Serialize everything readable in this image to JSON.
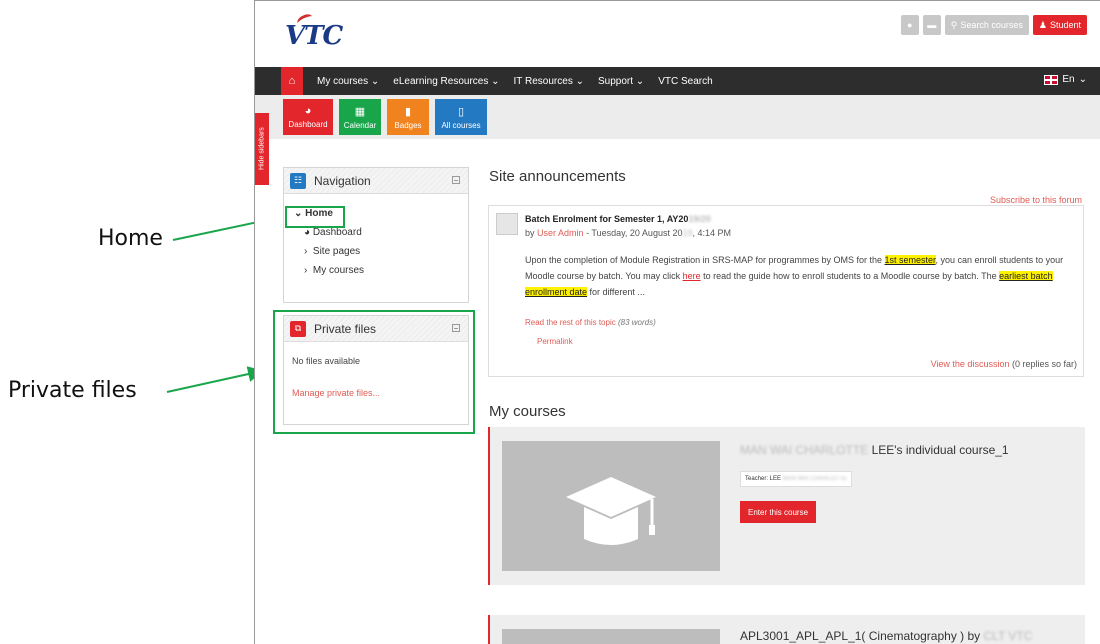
{
  "callouts": {
    "home": "Home",
    "private_files": "Private files"
  },
  "header": {
    "logo_text": "VTC",
    "search_label": "Search courses",
    "user_label": "Student"
  },
  "navbar": {
    "items": [
      "My courses",
      "eLearning Resources",
      "IT Resources",
      "Support",
      "VTC Search"
    ],
    "language": "En"
  },
  "quickbar": {
    "items": [
      {
        "label": "Dashboard",
        "color": "#e3262b"
      },
      {
        "label": "Calendar",
        "color": "#19a64b"
      },
      {
        "label": "Badges",
        "color": "#f0831e"
      },
      {
        "label": "All courses",
        "color": "#2479c3"
      }
    ]
  },
  "sidebar_toggle": "Hide sidebars",
  "navigation": {
    "title": "Navigation",
    "home": "Home",
    "items": [
      "Dashboard",
      "Site pages",
      "My courses"
    ]
  },
  "private_files": {
    "title": "Private files",
    "empty": "No files available",
    "manage": "Manage private files..."
  },
  "announcements": {
    "heading": "Site announcements",
    "subscribe": "Subscribe to this forum",
    "post": {
      "title": "Batch Enrolment for Semester 1, AY20",
      "title_blurred": "19/20",
      "by_prefix": "by",
      "author": "User Admin",
      "date_part1": " - Tuesday, 20 August 20",
      "date_blurred": "19",
      "date_part2": ", 4:14 PM",
      "body": {
        "t1": "Upon the completion of Module Registration in SRS-MAP for programmes by OMS for the ",
        "h1": "1st semester",
        "t2": ", you can enroll students to your Moodle course by batch. You may click ",
        "l1": "here",
        "t3": " to read the guide how to enroll students to a Moodle course by batch. The ",
        "h2": "earliest batch enrollment date",
        "t4": " for different ..."
      },
      "read_rest": "Read the rest of this topic",
      "word_count": "(83 words)",
      "permalink": "Permalink",
      "view_discussion": "View the discussion",
      "replies": " (0 replies so far)"
    }
  },
  "my_courses": {
    "heading": "My courses",
    "courses": [
      {
        "title_blurred": "MAN WAI CHARLOTTE",
        "title": " LEE's individual course_1",
        "teacher_label": "Teacher: LEE",
        "teacher_blurred": "MAN WAI CHARLOTTE",
        "button": "Enter this course"
      },
      {
        "title": "APL3001_APL_APL_1( Cinematography ) by ",
        "title_blurred": "CLT VTC"
      }
    ]
  }
}
